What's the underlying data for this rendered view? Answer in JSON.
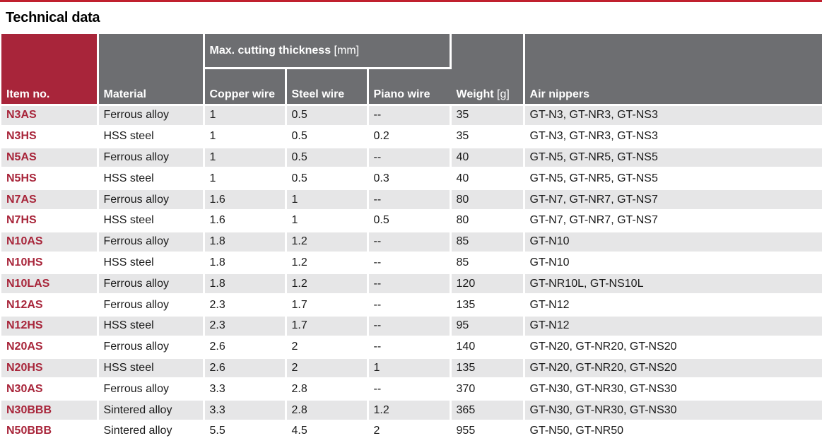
{
  "title": "Technical data",
  "headers": {
    "item_no": "Item no.",
    "material": "Material",
    "max_cutting_group": "Max. cutting thickness",
    "max_cutting_unit": "[mm]",
    "copper_wire": "Copper wire",
    "steel_wire": "Steel wire",
    "piano_wire": "Piano wire",
    "weight": "Weight",
    "weight_unit": "[g]",
    "air_nippers": "Air nippers"
  },
  "rows": [
    [
      "N3AS",
      "Ferrous alloy",
      "1",
      "0.5",
      "--",
      "35",
      "GT-N3, GT-NR3, GT-NS3"
    ],
    [
      "N3HS",
      "HSS steel",
      "1",
      "0.5",
      "0.2",
      "35",
      "GT-N3, GT-NR3, GT-NS3"
    ],
    [
      "N5AS",
      "Ferrous alloy",
      "1",
      "0.5",
      "--",
      "40",
      "GT-N5, GT-NR5, GT-NS5"
    ],
    [
      "N5HS",
      "HSS steel",
      "1",
      "0.5",
      "0.3",
      "40",
      "GT-N5, GT-NR5, GT-NS5"
    ],
    [
      "N7AS",
      "Ferrous alloy",
      "1.6",
      "1",
      "--",
      "80",
      "GT-N7, GT-NR7, GT-NS7"
    ],
    [
      "N7HS",
      "HSS steel",
      "1.6",
      "1",
      "0.5",
      "80",
      "GT-N7, GT-NR7, GT-NS7"
    ],
    [
      "N10AS",
      "Ferrous alloy",
      "1.8",
      "1.2",
      "--",
      "85",
      "GT-N10"
    ],
    [
      "N10HS",
      "HSS steel",
      "1.8",
      "1.2",
      "--",
      "85",
      "GT-N10"
    ],
    [
      "N10LAS",
      "Ferrous alloy",
      "1.8",
      "1.2",
      "--",
      "120",
      "GT-NR10L, GT-NS10L"
    ],
    [
      "N12AS",
      "Ferrous alloy",
      "2.3",
      "1.7",
      "--",
      "135",
      "GT-N12"
    ],
    [
      "N12HS",
      "HSS steel",
      "2.3",
      "1.7",
      "--",
      "95",
      "GT-N12"
    ],
    [
      "N20AS",
      "Ferrous alloy",
      "2.6",
      "2",
      "--",
      "140",
      "GT-N20, GT-NR20, GT-NS20"
    ],
    [
      "N20HS",
      "HSS steel",
      "2.6",
      "2",
      "1",
      "135",
      "GT-N20, GT-NR20, GT-NS20"
    ],
    [
      "N30AS",
      "Ferrous alloy",
      "3.3",
      "2.8",
      "--",
      "370",
      "GT-N30, GT-NR30, GT-NS30"
    ],
    [
      "N30BBB",
      "Sintered alloy",
      "3.3",
      "2.8",
      "1.2",
      "365",
      "GT-N30, GT-NR30, GT-NS30"
    ],
    [
      "N50BBB",
      "Sintered alloy",
      "5.5",
      "4.5",
      "2",
      "955",
      "GT-N50, GT-NR50"
    ]
  ],
  "colors": {
    "accent_red": "#a8253a",
    "header_gray": "#6d6e71",
    "row_stripe": "#e6e6e7"
  }
}
